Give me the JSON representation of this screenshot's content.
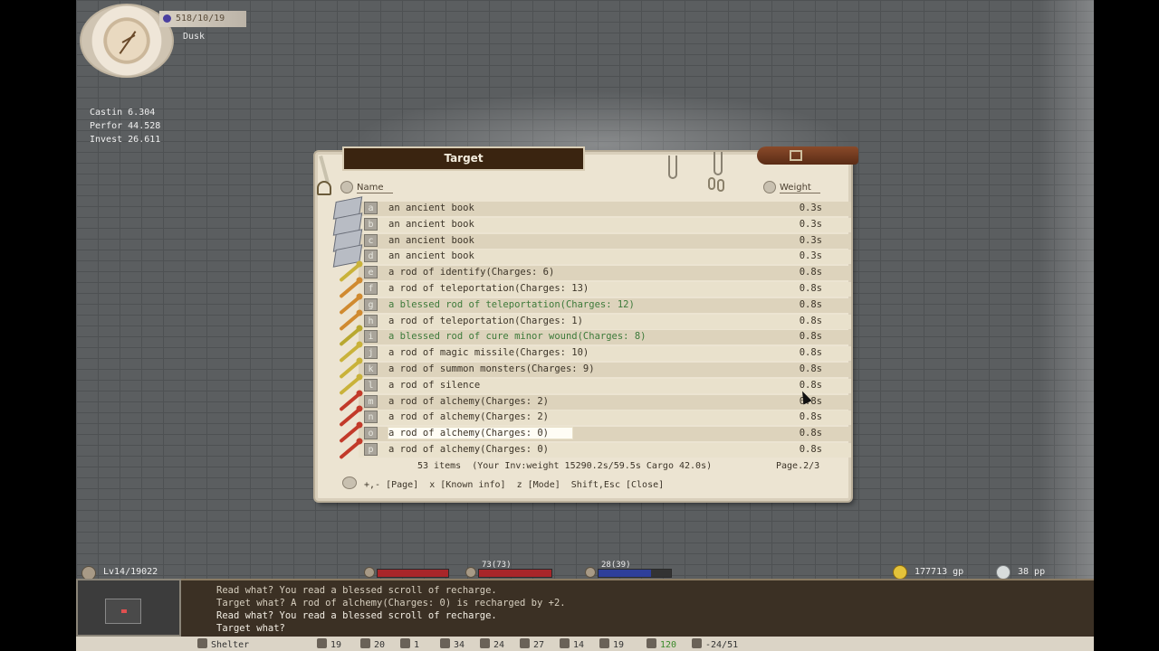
{
  "hud_top": {
    "date": "518/10/19",
    "time_of_day": "Dusk"
  },
  "skills": [
    {
      "name": "Castin",
      "value": "6.304"
    },
    {
      "name": "Perfor",
      "value": "44.528"
    },
    {
      "name": "Invest",
      "value": "26.611"
    }
  ],
  "window": {
    "title": "Target",
    "col_name": "Name",
    "col_weight": "Weight",
    "items": [
      {
        "key": "a",
        "icon": "book-icon",
        "name": "an ancient book",
        "weight": "0.3s",
        "blessed": false
      },
      {
        "key": "b",
        "icon": "book-icon",
        "name": "an ancient book",
        "weight": "0.3s",
        "blessed": false
      },
      {
        "key": "c",
        "icon": "book-icon",
        "name": "an ancient book",
        "weight": "0.3s",
        "blessed": false
      },
      {
        "key": "d",
        "icon": "book-icon",
        "name": "an ancient book",
        "weight": "0.3s",
        "blessed": false
      },
      {
        "key": "e",
        "icon": "rod-icon",
        "rod_color": "#c9b23a",
        "name": "a rod of identify(Charges: 6)",
        "weight": "0.8s",
        "blessed": false
      },
      {
        "key": "f",
        "icon": "rod-icon",
        "rod_color": "#d08a30",
        "name": "a rod of teleportation(Charges: 13)",
        "weight": "0.8s",
        "blessed": false
      },
      {
        "key": "g",
        "icon": "rod-icon",
        "rod_color": "#d08a30",
        "name": "a blessed rod of teleportation(Charges: 12)",
        "weight": "0.8s",
        "blessed": true
      },
      {
        "key": "h",
        "icon": "rod-icon",
        "rod_color": "#d08a30",
        "name": "a rod of teleportation(Charges: 1)",
        "weight": "0.8s",
        "blessed": false
      },
      {
        "key": "i",
        "icon": "rod-icon",
        "rod_color": "#b8a830",
        "name": "a blessed rod of cure minor wound(Charges: 8)",
        "weight": "0.8s",
        "blessed": true
      },
      {
        "key": "j",
        "icon": "rod-icon",
        "rod_color": "#c9b23a",
        "name": "a rod of magic missile(Charges: 10)",
        "weight": "0.8s",
        "blessed": false
      },
      {
        "key": "k",
        "icon": "rod-icon",
        "rod_color": "#c9b23a",
        "name": "a rod of summon monsters(Charges: 9)",
        "weight": "0.8s",
        "blessed": false
      },
      {
        "key": "l",
        "icon": "rod-icon",
        "rod_color": "#c9b23a",
        "name": "a rod of silence",
        "weight": "0.8s",
        "blessed": false
      },
      {
        "key": "m",
        "icon": "rod-icon",
        "rod_color": "#c23a2a",
        "name": "a rod of alchemy(Charges: 2)",
        "weight": "0.8s",
        "blessed": false
      },
      {
        "key": "n",
        "icon": "rod-icon",
        "rod_color": "#c23a2a",
        "name": "a rod of alchemy(Charges: 2)",
        "weight": "0.8s",
        "blessed": false
      },
      {
        "key": "o",
        "icon": "rod-icon",
        "rod_color": "#c23a2a",
        "name": "a rod of alchemy(Charges: 0)",
        "weight": "0.8s",
        "blessed": false,
        "highlighted": true
      },
      {
        "key": "p",
        "icon": "rod-icon",
        "rod_color": "#c23a2a",
        "name": "a rod of alchemy(Charges: 0)",
        "weight": "0.8s",
        "blessed": false
      }
    ],
    "summary": "53 items  (Your Inv:weight 15290.2s/59.5s Cargo 42.0s)",
    "page": "Page.2/3",
    "hint": "+,- [Page]  x [Known info]  z [Mode]  Shift,Esc [Close]"
  },
  "hud_bottom": {
    "level": "Lv14/19022",
    "hp_text": "73(73)",
    "hp_fraction": 1.0,
    "mp_text": "28(39)",
    "mp_fraction": 0.72,
    "gold": "177713 gp",
    "platinum": "38 pp",
    "colors": {
      "hp": "#a8262a",
      "mp": "#2e3f9a",
      "stamina": "#a8262a"
    }
  },
  "log": [
    "Read what?  You read a blessed scroll of recharge.",
    "Target what?  A rod of alchemy(Charges: 0) is recharged by +2.",
    "Read what?  You read a blessed scroll of recharge.",
    "Target what?"
  ],
  "status": {
    "location": "Shelter",
    "attrs": [
      "19",
      "20",
      "1",
      "34",
      "24",
      "27",
      "14",
      "19",
      "120",
      "-24/51"
    ]
  }
}
